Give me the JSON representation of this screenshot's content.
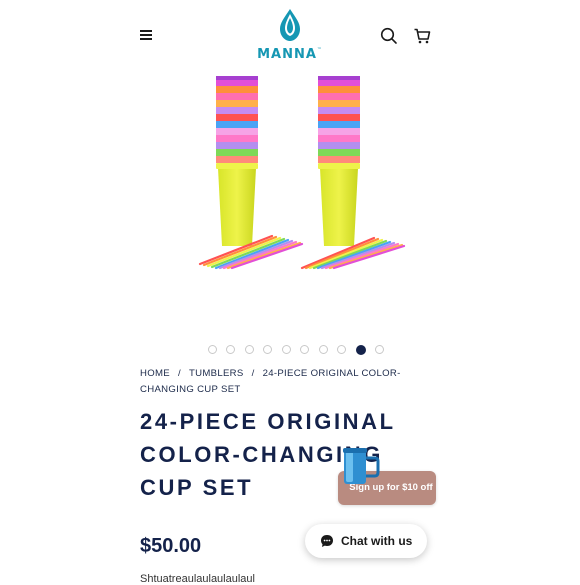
{
  "brand": {
    "name": "MANNA",
    "trademark": "™",
    "color": "#1597b3"
  },
  "header": {
    "menu_icon": "hamburger-icon",
    "search_icon": "search-icon",
    "cart_icon": "cart-icon"
  },
  "gallery": {
    "total_slides": 10,
    "active_slide": 9
  },
  "breadcrumb": {
    "home": "HOME",
    "separator1": "/",
    "category": "TUMBLERS",
    "separator2": "/",
    "current": "24-PIECE ORIGINAL COLOR-CHANGING CUP SET"
  },
  "product": {
    "title": "24-PIECE ORIGINAL COLOR-CHANGING CUP SET",
    "price": "$50.00",
    "description_partial": "Shtuatreaulaulaulaulaul"
  },
  "promo": {
    "signup_label": "Sign up for $10 off",
    "button_color": "#b98b80"
  },
  "chat": {
    "label": "Chat with us",
    "icon": "chat-bubble-icon"
  },
  "colors": {
    "navy": "#14224a",
    "accent": "#1597b3"
  }
}
